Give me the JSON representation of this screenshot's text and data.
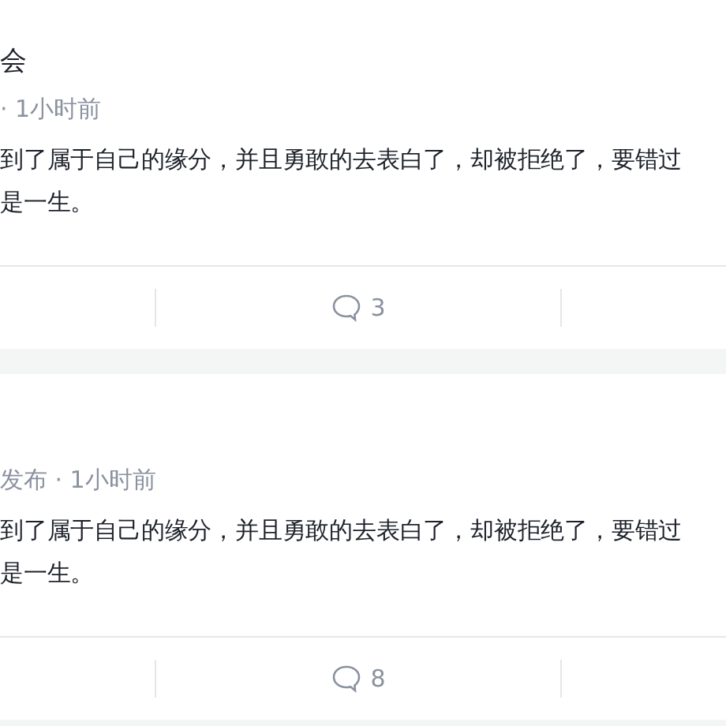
{
  "posts": [
    {
      "title": "会",
      "meta": "· 1小时前",
      "body_lines": [
        "到了属于自己的缘分，并且勇敢的去表白了，却被拒绝了，要错过",
        "是一生。"
      ],
      "comment_count": "3"
    },
    {
      "meta": "发布 · 1小时前",
      "body_lines": [
        "到了属于自己的缘分，并且勇敢的去表白了，却被拒绝了，要错过",
        "是一生。"
      ],
      "comment_count": "8"
    }
  ]
}
